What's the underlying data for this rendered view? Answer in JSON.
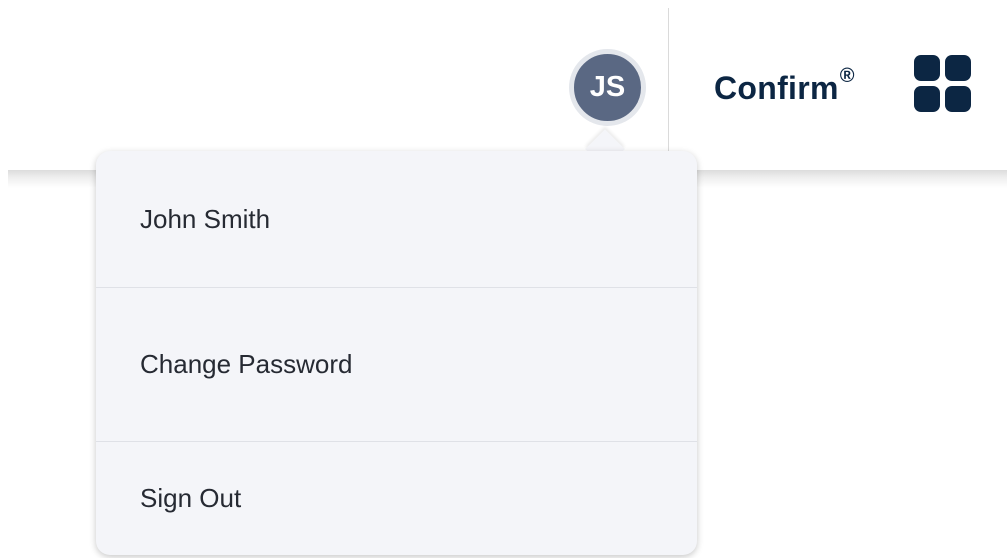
{
  "header": {
    "avatar_initials": "JS",
    "brand_name": "Confirm",
    "brand_mark": "®",
    "apps_icon": "grid-apps-icon"
  },
  "user_menu": {
    "user_name": "John Smith",
    "items": [
      {
        "label": "Change Password"
      },
      {
        "label": "Sign Out"
      }
    ]
  },
  "colors": {
    "avatar_bg": "#5a6883",
    "brand": "#0c2643",
    "menu_bg": "#f4f5f9",
    "menu_text": "#262a33"
  }
}
